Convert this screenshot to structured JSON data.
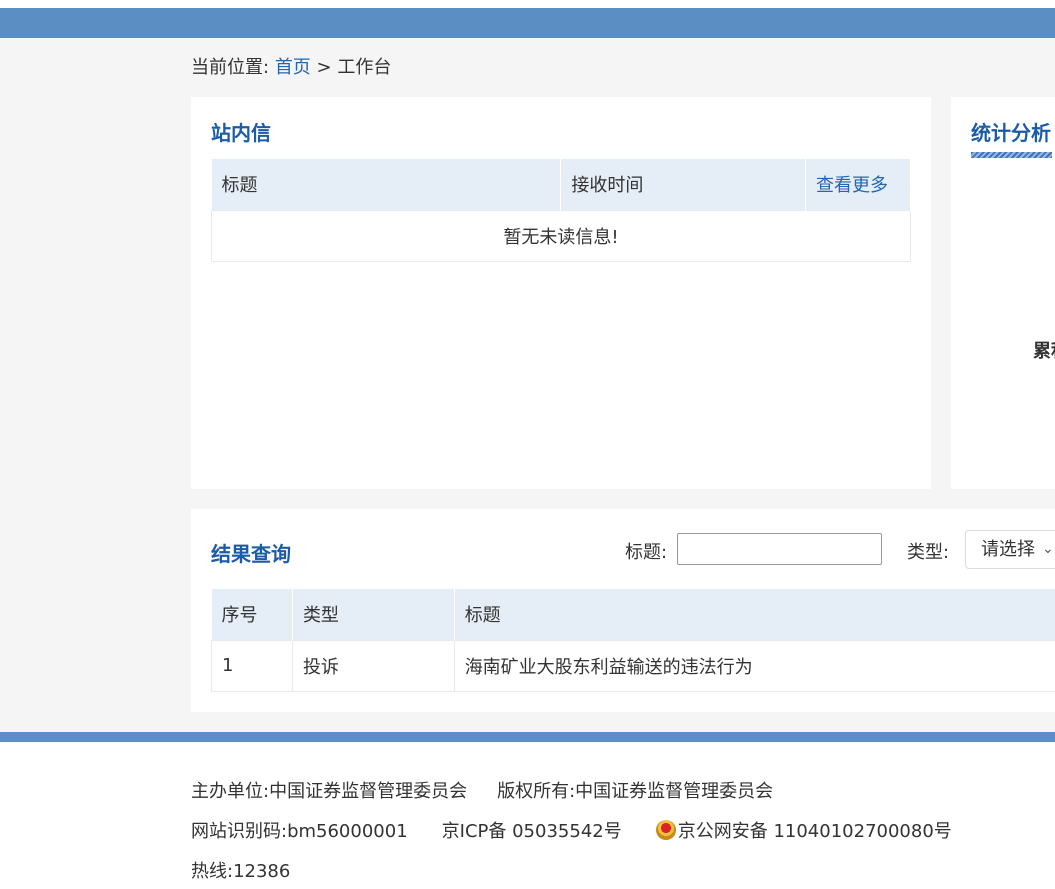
{
  "breadcrumb": {
    "prefix": "当前位置:",
    "home": "首页",
    "separator": ">",
    "current": "工作台"
  },
  "mail": {
    "title": "站内信",
    "columns": [
      "标题",
      "接收时间"
    ],
    "more_label": "查看更多",
    "empty_text": "暂无未读信息!"
  },
  "stats": {
    "title": "统计分析",
    "partial_label": "累积"
  },
  "results": {
    "title": "结果查询",
    "title_filter_label": "标题:",
    "title_filter_value": "",
    "type_filter_label": "类型:",
    "type_select_value": "请选择",
    "columns": [
      "序号",
      "类型",
      "标题"
    ],
    "rows": [
      {
        "index": "1",
        "type": "投诉",
        "title": "海南矿业大股东利益输送的违法行为"
      }
    ]
  },
  "footer": {
    "sponsor": "主办单位:中国证券监督管理委员会",
    "copyright": "版权所有:中国证券监督管理委员会",
    "site_code": "网站识别码:bm56000001",
    "icp": "京ICP备 05035542号",
    "police_record": "京公网安备 11040102700080号",
    "hotline": "热线:12386"
  },
  "colors": {
    "top_bar": "#5b8ec2",
    "accent": "#1b5ba8",
    "link": "#2366b0",
    "table_header": "#e5edf7"
  }
}
